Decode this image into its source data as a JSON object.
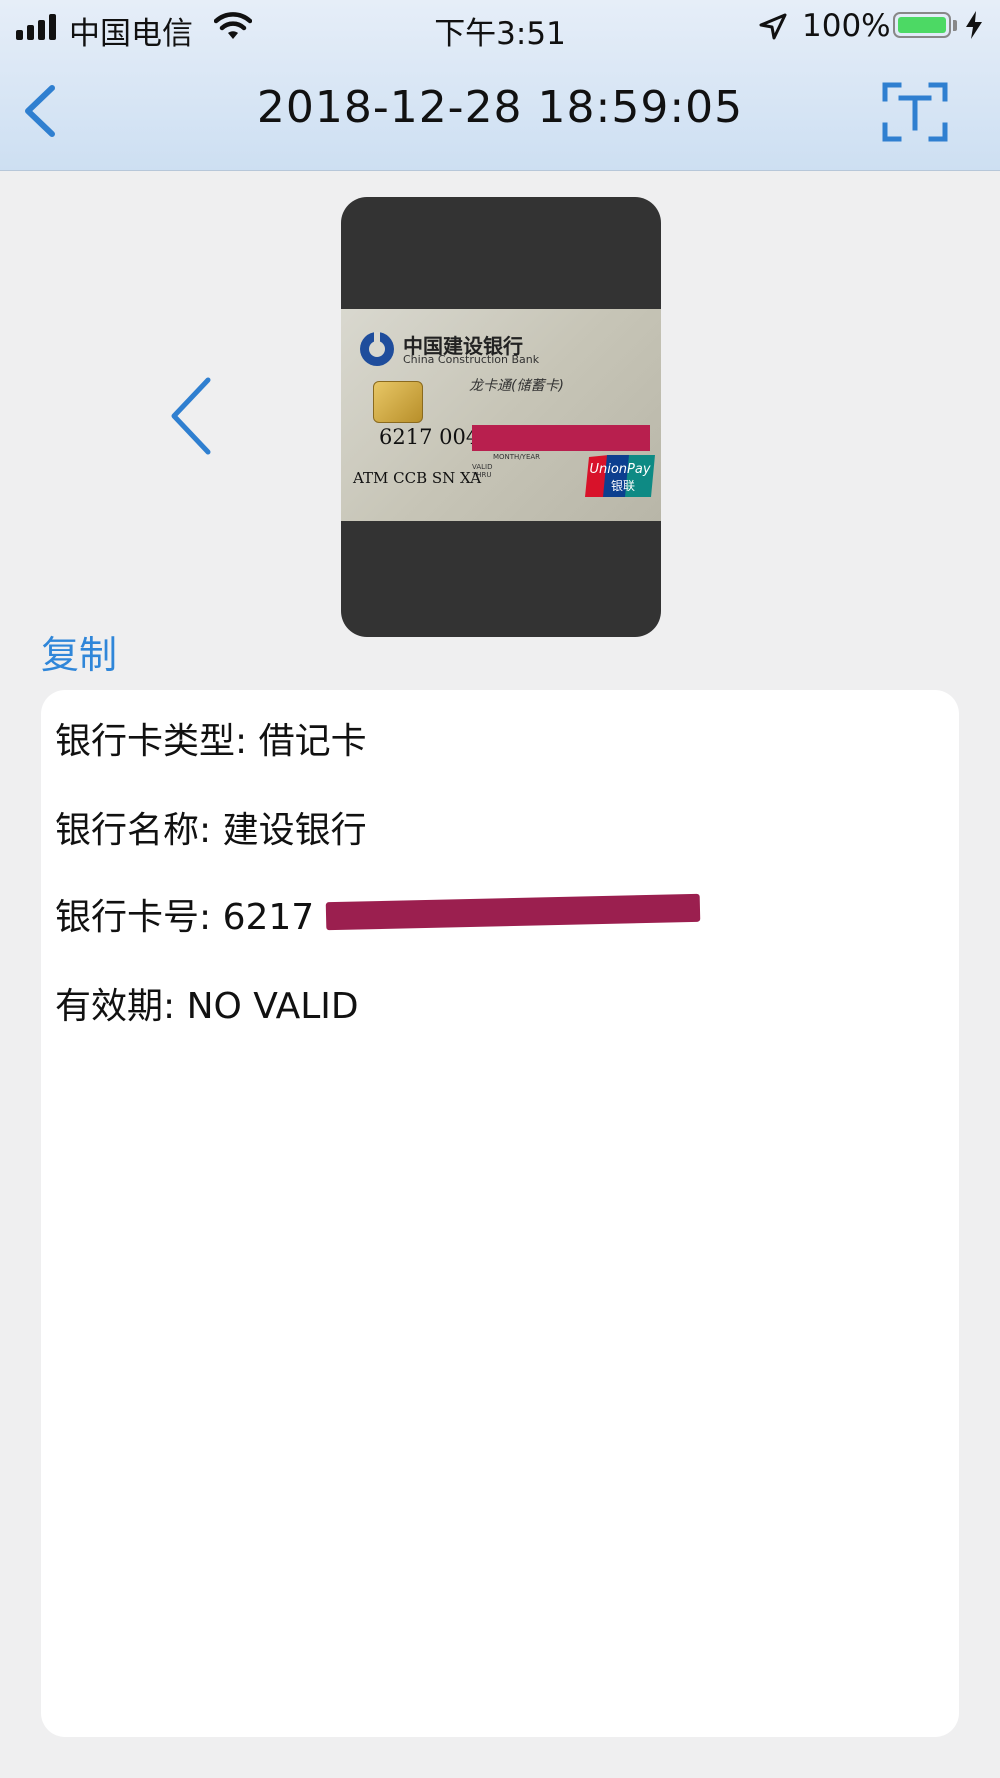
{
  "status_bar": {
    "carrier": "中国电信",
    "time": "下午3:51",
    "battery": "100%",
    "battery_level": 1.0
  },
  "nav": {
    "title": "2018-12-28 18:59:05",
    "back_icon": "chevron-left-icon",
    "scan_icon": "text-scan-icon"
  },
  "preview": {
    "card": {
      "bank_name_cn": "中国建设银行",
      "bank_name_en": "China Construction Bank",
      "product": "龙卡通(储蓄卡)",
      "number_visible": "6217 004",
      "small_label_1": "MONTH/YEAR",
      "small_label_2": "VALID",
      "small_label_3": "THRU",
      "branch": "ATM CCB SN XA",
      "unionpay_en": "UnionPay",
      "unionpay_cn": "银联"
    }
  },
  "actions": {
    "copy_label": "复制"
  },
  "result": {
    "lines": [
      "银行卡类型: 借记卡",
      "银行名称: 建设银行",
      "银行卡号: 6217",
      "有效期: NO VALID"
    ]
  },
  "colors": {
    "accent": "#2f86d9",
    "redaction": "#9b1f4f",
    "battery": "#4cd964"
  }
}
